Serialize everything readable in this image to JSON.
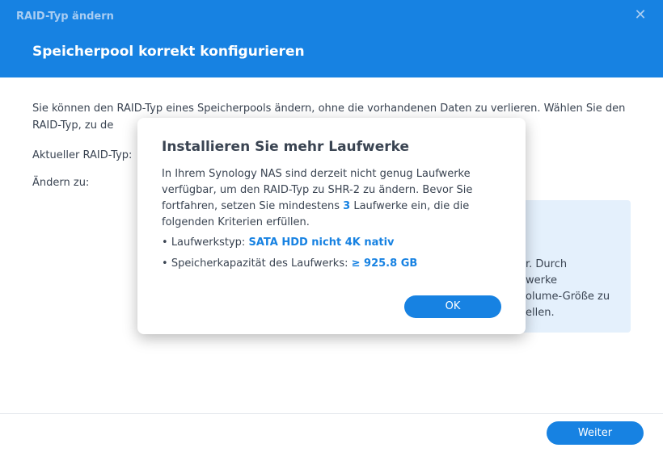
{
  "window": {
    "title": "RAID-Typ ändern",
    "close_symbol": "✕"
  },
  "step_title": "Speicherpool korrekt konfigurieren",
  "intro_text": "Sie können den RAID-Typ eines Speicherpools ändern, ohne die vorhandenen Daten zu verlieren. Wählen Sie den RAID-Typ, zu de",
  "current_raid_label": "Aktueller RAID-Typ:",
  "change_to_label": "Ändern zu:",
  "info_fragments": [
    "r. Durch",
    "werke",
    "olume-Größe zu",
    "ellen."
  ],
  "footer": {
    "next_button": "Weiter"
  },
  "dialog": {
    "title": "Installieren Sie mehr Laufwerke",
    "para_part1": "In Ihrem Synology NAS sind derzeit nicht genug Laufwerke verfügbar, um den RAID-Typ zu SHR-2 zu ändern. Bevor Sie fortfahren, setzen Sie mindestens ",
    "para_count": "3",
    "para_part2": " Laufwerke ein, die die folgenden Kriterien erfüllen.",
    "bullet_symbol": "•",
    "criteria": [
      {
        "label": "Laufwerkstyp:",
        "value": "SATA HDD nicht 4K nativ"
      },
      {
        "label": "Speicherkapazität des Laufwerks:",
        "value": "≥ 925.8 GB"
      }
    ],
    "ok_button": "OK"
  },
  "colors": {
    "accent": "#1782e2",
    "header_muted_text": "#a9cdf2",
    "info_bg": "#e4f0fc",
    "text": "#3a4452"
  }
}
